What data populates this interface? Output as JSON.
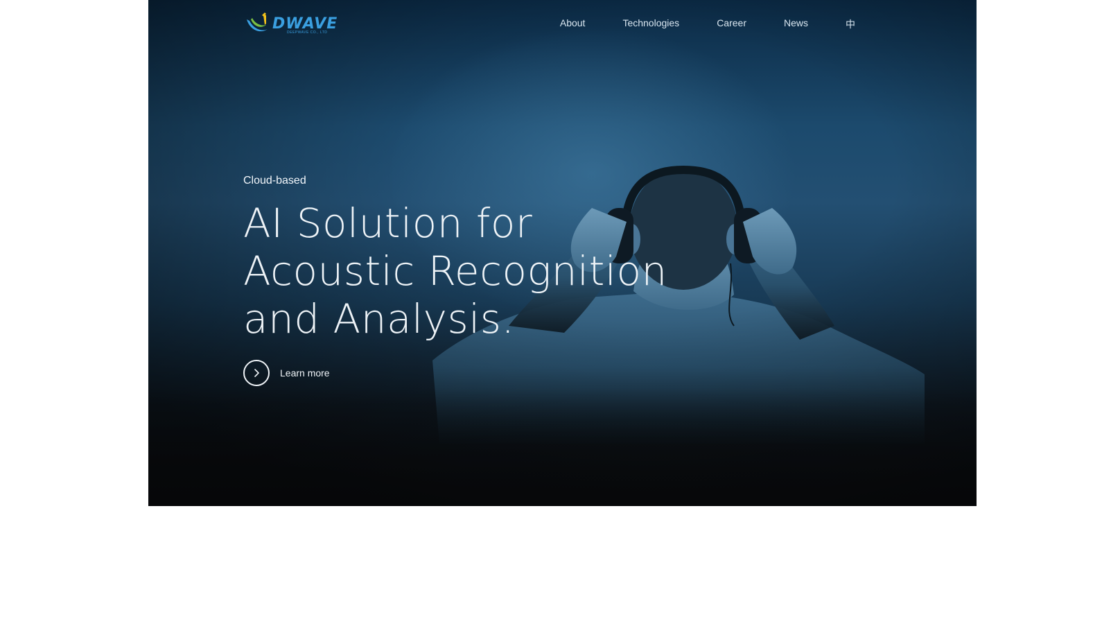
{
  "logo": {
    "text": "DWAVE",
    "subtext": "DEEPWAVE CO., LTD"
  },
  "nav": {
    "items": [
      {
        "label": "About"
      },
      {
        "label": "Technologies"
      },
      {
        "label": "Career"
      },
      {
        "label": "News"
      },
      {
        "label": "中"
      }
    ]
  },
  "hero": {
    "eyebrow": "Cloud-based",
    "headline_lines": [
      "AI Solution for",
      "Acoustic Recognition",
      "and Analysis."
    ],
    "cta_label": "Learn more",
    "cta_icon": "chevron-right-icon"
  },
  "colors": {
    "logo_blue": "#3a9fe0",
    "logo_green": "#7bc043",
    "logo_yellow": "#f2c21b",
    "hero_top": "#0b2a45",
    "hero_bottom": "#0b0d10",
    "text": "#eef3f7"
  }
}
